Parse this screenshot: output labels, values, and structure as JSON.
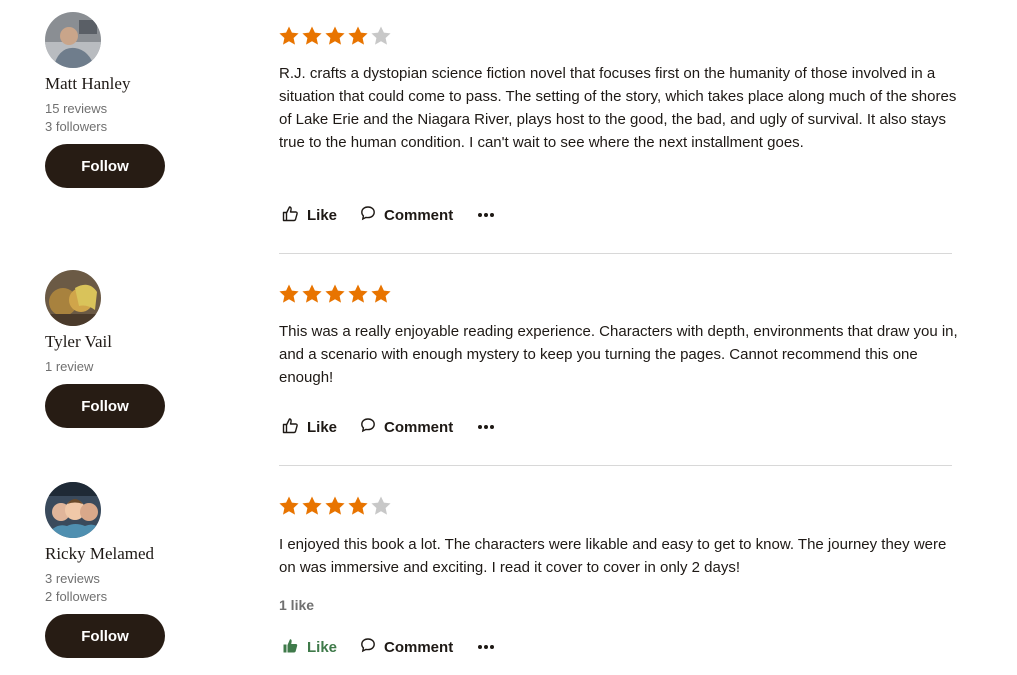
{
  "colors": {
    "star_filled": "#e87400",
    "star_empty": "#c8c8c8",
    "follow_button_bg": "#271c14",
    "liked_green": "#3f7a4a"
  },
  "reviews": [
    {
      "reviewer": {
        "name": "Matt Hanley",
        "reviews": "15 reviews",
        "followers": "3 followers"
      },
      "follow_label": "Follow",
      "rating": 4,
      "text": "R.J. crafts a dystopian science fiction novel that focuses first on the humanity of those involved in a situation that could come to pass. The setting of the story, which takes place along much of the shores of Lake Erie and the Niagara River, plays host to the good, the bad, and ugly of survival. It also stays true to the human condition. I can't wait to see where the next installment goes.",
      "like_label": "Like",
      "comment_label": "Comment"
    },
    {
      "reviewer": {
        "name": "Tyler Vail",
        "reviews": "1 review"
      },
      "follow_label": "Follow",
      "rating": 5,
      "text": "This was a really enjoyable reading experience. Characters with depth, environments that draw you in, and a scenario with enough mystery to keep you turning the pages. Cannot recommend this one enough!",
      "like_label": "Like",
      "comment_label": "Comment"
    },
    {
      "reviewer": {
        "name": "Ricky Melamed",
        "reviews": "3 reviews",
        "followers": "2 followers"
      },
      "follow_label": "Follow",
      "rating": 4,
      "text": "I enjoyed this book a lot. The characters were likable and easy to get to know. The journey they were on was immersive and exciting. I read it cover to cover in only 2 days!",
      "likes_count": "1 like",
      "like_label": "Like",
      "liked": true,
      "comment_label": "Comment"
    }
  ]
}
